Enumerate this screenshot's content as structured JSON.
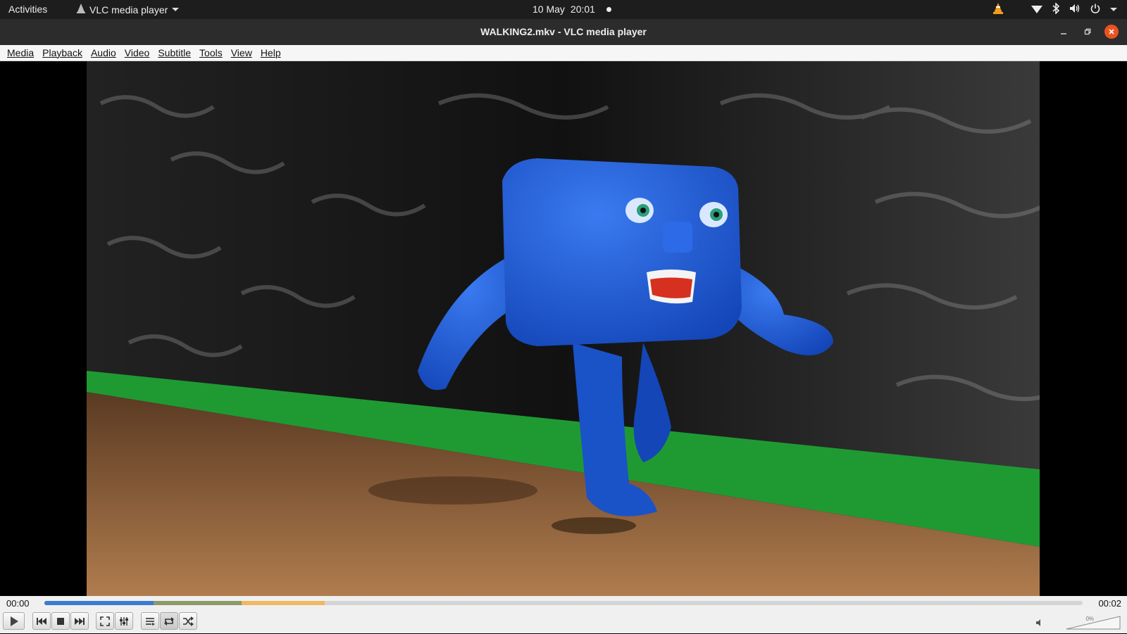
{
  "topbar": {
    "activities": "Activities",
    "app_name": "VLC media player",
    "date": "10 May",
    "time": "20:01"
  },
  "window": {
    "title": "WALKING2.mkv - VLC media player"
  },
  "menu": [
    "Media",
    "Playback",
    "Audio",
    "Video",
    "Subtitle",
    "Tools",
    "View",
    "Help"
  ],
  "playback": {
    "elapsed": "00:00",
    "total": "00:02",
    "progress_fraction": 0.105,
    "buffered_fraction": 0.27,
    "buffered2_fraction": 0.19,
    "volume_text": "0%",
    "volume_fraction": 0.0
  },
  "colors": {
    "accent": "#3c7bd0",
    "close": "#e95420",
    "character": "#1f5ed6",
    "grass": "#1f9a33",
    "ground": "#9b6a43"
  },
  "icons": [
    "vlc-cone-icon",
    "wifi-icon",
    "bluetooth-icon",
    "speaker-icon",
    "power-icon",
    "play-icon",
    "previous-icon",
    "stop-icon",
    "next-icon",
    "fullscreen-icon",
    "extended-settings-icon",
    "playlist-icon",
    "loop-icon",
    "shuffle-icon",
    "mute-icon"
  ]
}
